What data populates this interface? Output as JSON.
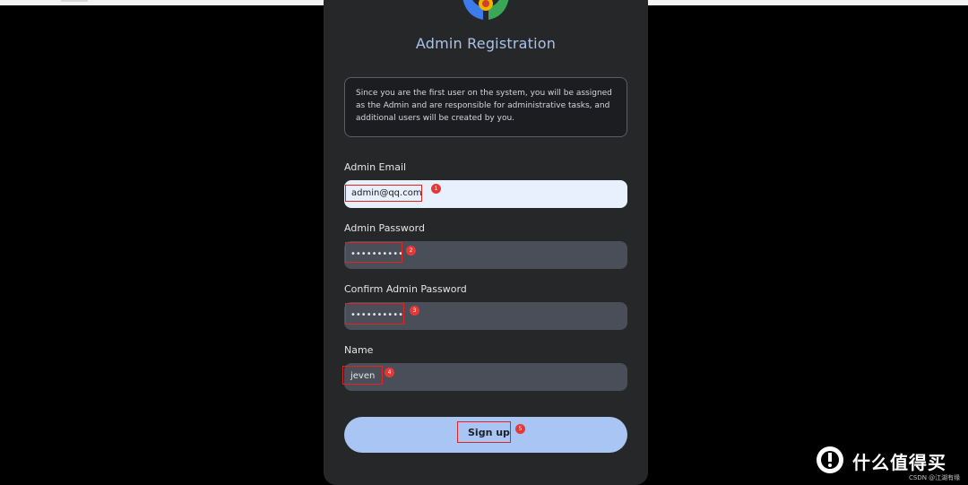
{
  "form": {
    "title": "Admin Registration",
    "notice_lines": [
      "Since you are the first user on the system, you will be assigned",
      "as the Admin and are responsible for administrative tasks, and",
      "additional users will be created by you."
    ],
    "email": {
      "label": "Admin Email",
      "value": "admin@qq.com"
    },
    "password": {
      "label": "Admin Password",
      "value": "••••••••••"
    },
    "confirm_password": {
      "label": "Confirm Admin Password",
      "value": "••••••••••"
    },
    "name": {
      "label": "Name",
      "value": "jeven"
    },
    "submit_label": "Sign up"
  },
  "annotations": [
    "1",
    "2",
    "3",
    "4",
    "5"
  ],
  "watermark": {
    "text": "什么值得买",
    "sub": "CSDN @江湖有缘"
  },
  "colors": {
    "background": "#000000",
    "card": "#262729",
    "accent": "#a9c5f3",
    "highlight": "#e02424"
  }
}
